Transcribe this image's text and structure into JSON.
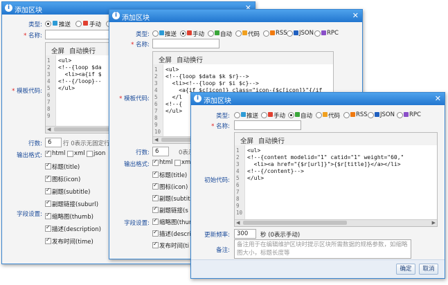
{
  "dialog_title": "添加区块",
  "labels": {
    "type": "类型:",
    "name": "名称:",
    "template_code": "模板代码:",
    "initial_code": "初始代码:",
    "row_count": "行数:",
    "output_format": "输出格式:",
    "field_settings": "字段设置:",
    "update_freq": "更新频率:",
    "remark": "备注:"
  },
  "type_options": [
    "推送",
    "手动",
    "自动",
    "代码",
    "RSS",
    "JSON",
    "RPC"
  ],
  "type_colors": [
    "#2d9bd6",
    "#e04030",
    "#3aa63a",
    "#f0a020",
    "#f07a10",
    "#2060c0",
    "#8a4fc8"
  ],
  "editor_toolbar": {
    "fullscreen": "全屏",
    "wrap": "自动换行"
  },
  "dialog1": {
    "code_lines": [
      "<ul>",
      "<!--{loop $da",
      "  <li><a{if $",
      "<!--{/loop}--",
      "</ul>"
    ],
    "rows_value": "6",
    "rows_hint": "行 0表示无固定行数",
    "formats": [
      "html",
      "xml",
      "json"
    ],
    "fields": [
      "标题(title)",
      "图标(icon)",
      "副题(subtitle)",
      "副题链接(suburl)",
      "缩略图(thumb)",
      "描述(description)",
      "发布时间(time)"
    ]
  },
  "dialog2": {
    "code_lines": [
      "<ul>",
      "<!--{loop $data $k $r}-->",
      "  <li><!--{loop $r $i $c}-->",
      "    <a{if $c[icon]} class=\"icon-{$c[icon]}\"{/if",
      "  </l",
      "<!--{",
      "</ul>"
    ],
    "rows_value": "6",
    "rows_hint": "0表示",
    "formats": [
      "html",
      "xml"
    ],
    "fields": [
      "标题(title)",
      "图标(icon)",
      "副题(subtitle)",
      "副题链接(s",
      "缩略图(thum",
      "描述(descri",
      "发布时间(ti"
    ]
  },
  "dialog3": {
    "code_lines": [
      "<ul>",
      "<!--{content modelid=\"1\" catid=\"1\" weight=\"60,\"",
      "  <li><a href=\"{$r[url]}\">{$r[title]}</a></li>",
      "<!--{/content}-->",
      "</ul>"
    ],
    "update_value": "300",
    "update_hint": "秒 (0表示手动)",
    "remark_placeholder": "备注用于在编辑维护区块时提示区块所需数据的规格参数，如缩略图大小，标题长度等",
    "ok": "确定",
    "cancel": "取消"
  },
  "line_numbers": [
    "1",
    "2",
    "3",
    "4",
    "5",
    "6",
    "7",
    "8",
    "9",
    "10"
  ]
}
